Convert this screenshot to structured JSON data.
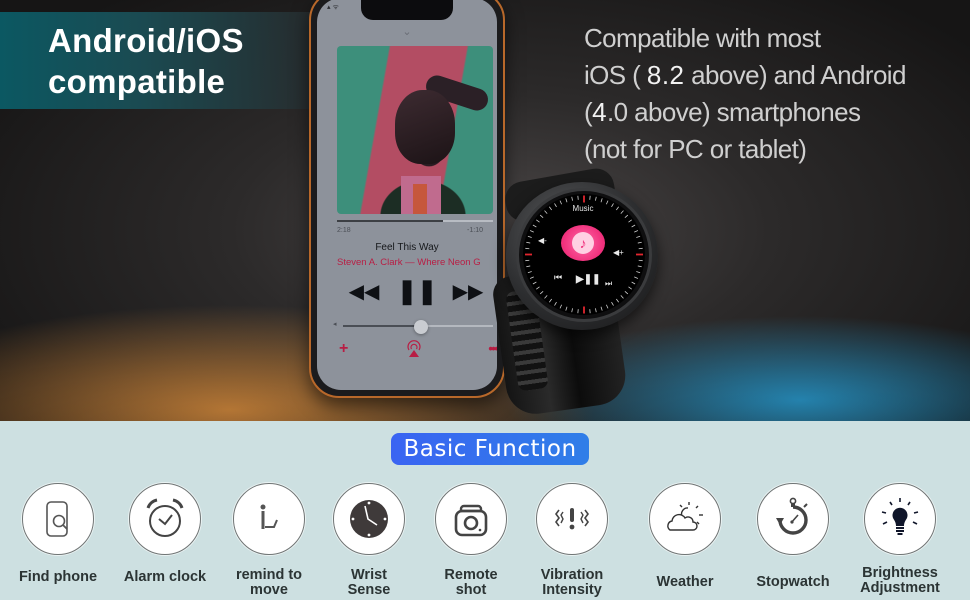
{
  "hero": {
    "title_line1": "Android/iOS",
    "title_line2": "compatible",
    "compat": {
      "line1": "Compatible with most",
      "line2_pre": "iOS ( ",
      "line2_version": "8.2",
      "line2_post": " above) and Android",
      "line3_pre": "(",
      "line3_version": "4",
      "line3_post": ".0 above) smartphones",
      "line4": "(not for PC or tablet)"
    }
  },
  "phone": {
    "now_playing": {
      "elapsed": "2:18",
      "remaining": "-1:10",
      "progress_fraction": 0.68,
      "title": "Feel This Way",
      "artist_album": "Steven A. Clark — Where Neon G",
      "volume_fraction": 0.52
    },
    "icons": {
      "chevron": "chevron-down-icon",
      "rewind": "rewind-icon",
      "pause": "pause-icon",
      "forward": "fast-forward-icon",
      "add": "plus-icon",
      "airplay": "airplay-icon",
      "more": "more-icon"
    },
    "glyphs": {
      "chevron": "⌄",
      "rewind": "◀◀",
      "pause": "❚❚",
      "forward": "▶▶",
      "add": "+",
      "more": "•••",
      "vol_min": "◂",
      "status": "▴ ᯤ"
    }
  },
  "watch": {
    "screen_title": "Music",
    "glyphs": {
      "note": "♪",
      "vol_down": "◀-",
      "vol_up": "◀+",
      "prev": "⏮",
      "playpause": "▶❚❚",
      "next": "⏭"
    },
    "accent_color": "#f0307c"
  },
  "functions": {
    "section_title": "Basic Function",
    "items": [
      {
        "label_line1": "Find phone",
        "label_line2": "",
        "icon": "find-phone-icon"
      },
      {
        "label_line1": "Alarm clock",
        "label_line2": "",
        "icon": "alarm-clock-icon"
      },
      {
        "label_line1": "remind to",
        "label_line2": "move",
        "icon": "sedentary-reminder-icon"
      },
      {
        "label_line1": "Wrist",
        "label_line2": "Sense",
        "icon": "wrist-sense-clock-icon"
      },
      {
        "label_line1": "Remote",
        "label_line2": "shot",
        "icon": "camera-icon"
      },
      {
        "label_line1": "Vibration",
        "label_line2": "Intensity",
        "icon": "vibration-icon"
      },
      {
        "label_line1": "Weather",
        "label_line2": "",
        "icon": "weather-icon"
      },
      {
        "label_line1": "Stopwatch",
        "label_line2": "",
        "icon": "stopwatch-icon"
      },
      {
        "label_line1": "Brightness",
        "label_line2": "Adjustment",
        "icon": "light-bulb-icon"
      }
    ]
  },
  "colors": {
    "title_band": "#0b5862",
    "pill": "#3a64f2",
    "panel": "#cde0e1",
    "label": "#2b3434",
    "accent_red": "#b81e44"
  }
}
